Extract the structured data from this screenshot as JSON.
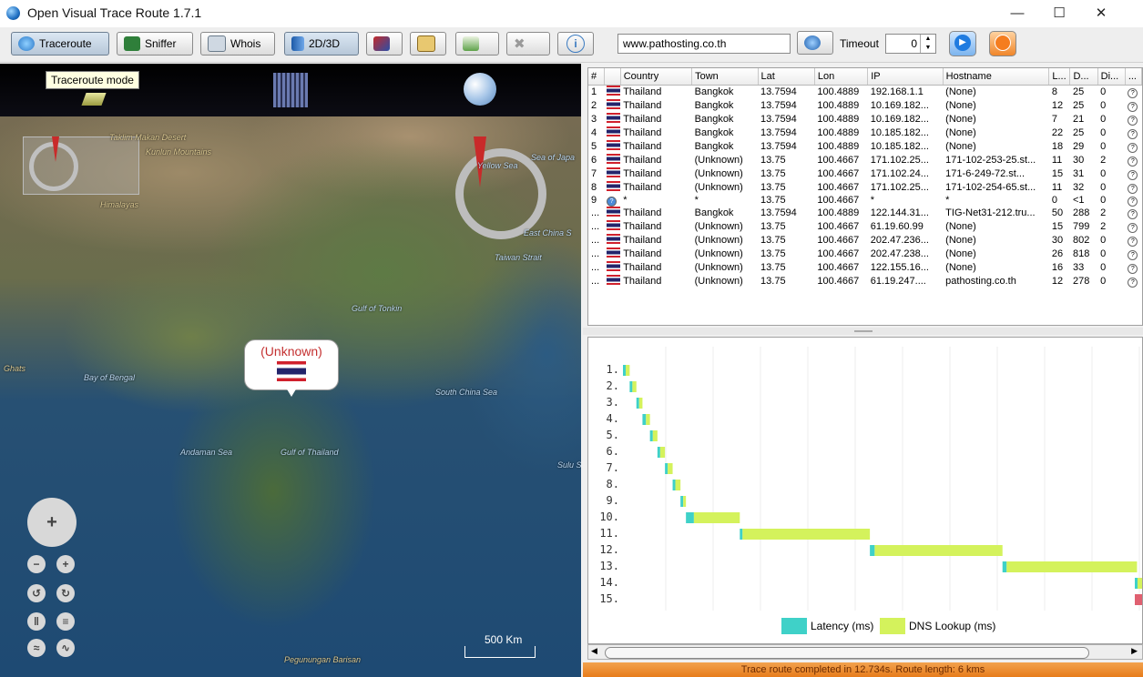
{
  "window": {
    "title": "Open Visual Trace Route 1.7.1"
  },
  "toolbar": {
    "traceroute_label": "Traceroute",
    "sniffer_label": "Sniffer",
    "whois_label": "Whois",
    "mode_label": "2D/3D",
    "url_value": "www.pathosting.co.th",
    "timeout_label": "Timeout",
    "timeout_value": "0"
  },
  "map": {
    "tooltip": "Traceroute mode",
    "callout_label": "(Unknown)",
    "scale_label": "500 Km",
    "labels": [
      "Taklim Makan Desert",
      "Kunlun Mountains",
      "Himalayas",
      "Bay of Bengal",
      "Andaman Sea",
      "Gulf of Thailand",
      "Gulf of Tonkin",
      "South China Sea",
      "Taiwan Strait",
      "East China S",
      "Yellow Sea",
      "Sea of Japa",
      "Pegunungan Barisan",
      "Sulu S",
      "Ghats"
    ]
  },
  "table": {
    "columns": [
      "#",
      "",
      "Country",
      "Town",
      "Lat",
      "Lon",
      "IP",
      "Hostname",
      "L...",
      "D...",
      "Di...",
      "..."
    ],
    "rows": [
      [
        "1",
        "Thailand",
        "Bangkok",
        "13.7594",
        "100.4889",
        "192.168.1.1",
        "(None)",
        "8",
        "25",
        "0"
      ],
      [
        "2",
        "Thailand",
        "Bangkok",
        "13.7594",
        "100.4889",
        "10.169.182...",
        "(None)",
        "12",
        "25",
        "0"
      ],
      [
        "3",
        "Thailand",
        "Bangkok",
        "13.7594",
        "100.4889",
        "10.169.182...",
        "(None)",
        "7",
        "21",
        "0"
      ],
      [
        "4",
        "Thailand",
        "Bangkok",
        "13.7594",
        "100.4889",
        "10.185.182...",
        "(None)",
        "22",
        "25",
        "0"
      ],
      [
        "5",
        "Thailand",
        "Bangkok",
        "13.7594",
        "100.4889",
        "10.185.182...",
        "(None)",
        "18",
        "29",
        "0"
      ],
      [
        "6",
        "Thailand",
        "(Unknown)",
        "13.75",
        "100.4667",
        "171.102.25...",
        "171-102-253-25.st...",
        "11",
        "30",
        "2"
      ],
      [
        "7",
        "Thailand",
        "(Unknown)",
        "13.75",
        "100.4667",
        "171.102.24...",
        "171-6-249-72.st...",
        "15",
        "31",
        "0"
      ],
      [
        "8",
        "Thailand",
        "(Unknown)",
        "13.75",
        "100.4667",
        "171.102.25...",
        "171-102-254-65.st...",
        "11",
        "32",
        "0"
      ],
      [
        "9",
        "*",
        "*",
        "13.75",
        "100.4667",
        "*",
        "*",
        "0",
        "<1",
        "0"
      ],
      [
        "...",
        "Thailand",
        "Bangkok",
        "13.7594",
        "100.4889",
        "122.144.31...",
        "TIG-Net31-212.tru...",
        "50",
        "288",
        "2"
      ],
      [
        "...",
        "Thailand",
        "(Unknown)",
        "13.75",
        "100.4667",
        "61.19.60.99",
        "(None)",
        "15",
        "799",
        "2"
      ],
      [
        "...",
        "Thailand",
        "(Unknown)",
        "13.75",
        "100.4667",
        "202.47.236...",
        "(None)",
        "30",
        "802",
        "0"
      ],
      [
        "...",
        "Thailand",
        "(Unknown)",
        "13.75",
        "100.4667",
        "202.47.238...",
        "(None)",
        "26",
        "818",
        "0"
      ],
      [
        "...",
        "Thailand",
        "(Unknown)",
        "13.75",
        "100.4667",
        "122.155.16...",
        "(None)",
        "16",
        "33",
        "0"
      ],
      [
        "...",
        "Thailand",
        "(Unknown)",
        "13.75",
        "100.4667",
        "61.19.247....",
        "pathosting.co.th",
        "12",
        "278",
        "0"
      ]
    ]
  },
  "chart_data": {
    "type": "bar",
    "orientation": "horizontal-gantt",
    "categories": [
      "1.",
      "2.",
      "3.",
      "4.",
      "5.",
      "6.",
      "7.",
      "8.",
      "9.",
      "10.",
      "11.",
      "12.",
      "13.",
      "14.",
      "15."
    ],
    "series": [
      {
        "name": "Latency (ms)",
        "color": "#3fd1c8",
        "values": [
          8,
          12,
          7,
          22,
          18,
          11,
          15,
          11,
          0,
          50,
          15,
          30,
          26,
          16,
          12
        ]
      },
      {
        "name": "DNS Lookup (ms)",
        "color": "#d4f25c",
        "values": [
          25,
          25,
          21,
          25,
          29,
          30,
          31,
          32,
          1,
          288,
          799,
          802,
          818,
          33,
          278
        ]
      }
    ],
    "legend_position": "bottom",
    "grid": true
  },
  "status": {
    "text": "Trace route completed in 12.734s. Route length: 6 kms"
  }
}
